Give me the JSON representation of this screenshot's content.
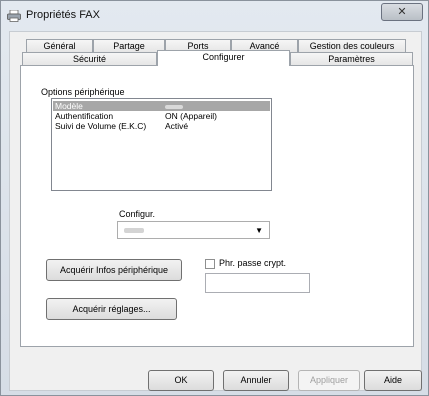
{
  "window": {
    "title": "Propriétés FAX",
    "close_label": "✕",
    "icon": "printer-icon"
  },
  "tabs": {
    "row_back": [
      {
        "label": "Général"
      },
      {
        "label": "Partage"
      },
      {
        "label": "Ports"
      },
      {
        "label": "Avancé"
      },
      {
        "label": "Gestion des couleurs"
      }
    ],
    "row_front": [
      {
        "label": "Sécurité"
      },
      {
        "label": "Configurer",
        "active": true
      },
      {
        "label": "Paramètres"
      }
    ]
  },
  "device_options": {
    "group_label": "Options périphérique",
    "rows": [
      {
        "name": "Modèle",
        "selected": true
      },
      {
        "name": "Authentification",
        "value": "ON (Appareil)"
      },
      {
        "name": "Suivi de Volume (E.K.C)",
        "value": "Activé"
      }
    ]
  },
  "config": {
    "label": "Configur.",
    "arrow": "▼"
  },
  "actions": {
    "acquire_info": "Acquérir Infos périphérique",
    "acquire_settings": "Acquérir réglages...",
    "passphrase_label": "Phr. passe crypt.",
    "passphrase_value": ""
  },
  "footer": {
    "ok": "OK",
    "cancel": "Annuler",
    "apply": "Appliquer",
    "help": "Aide"
  }
}
